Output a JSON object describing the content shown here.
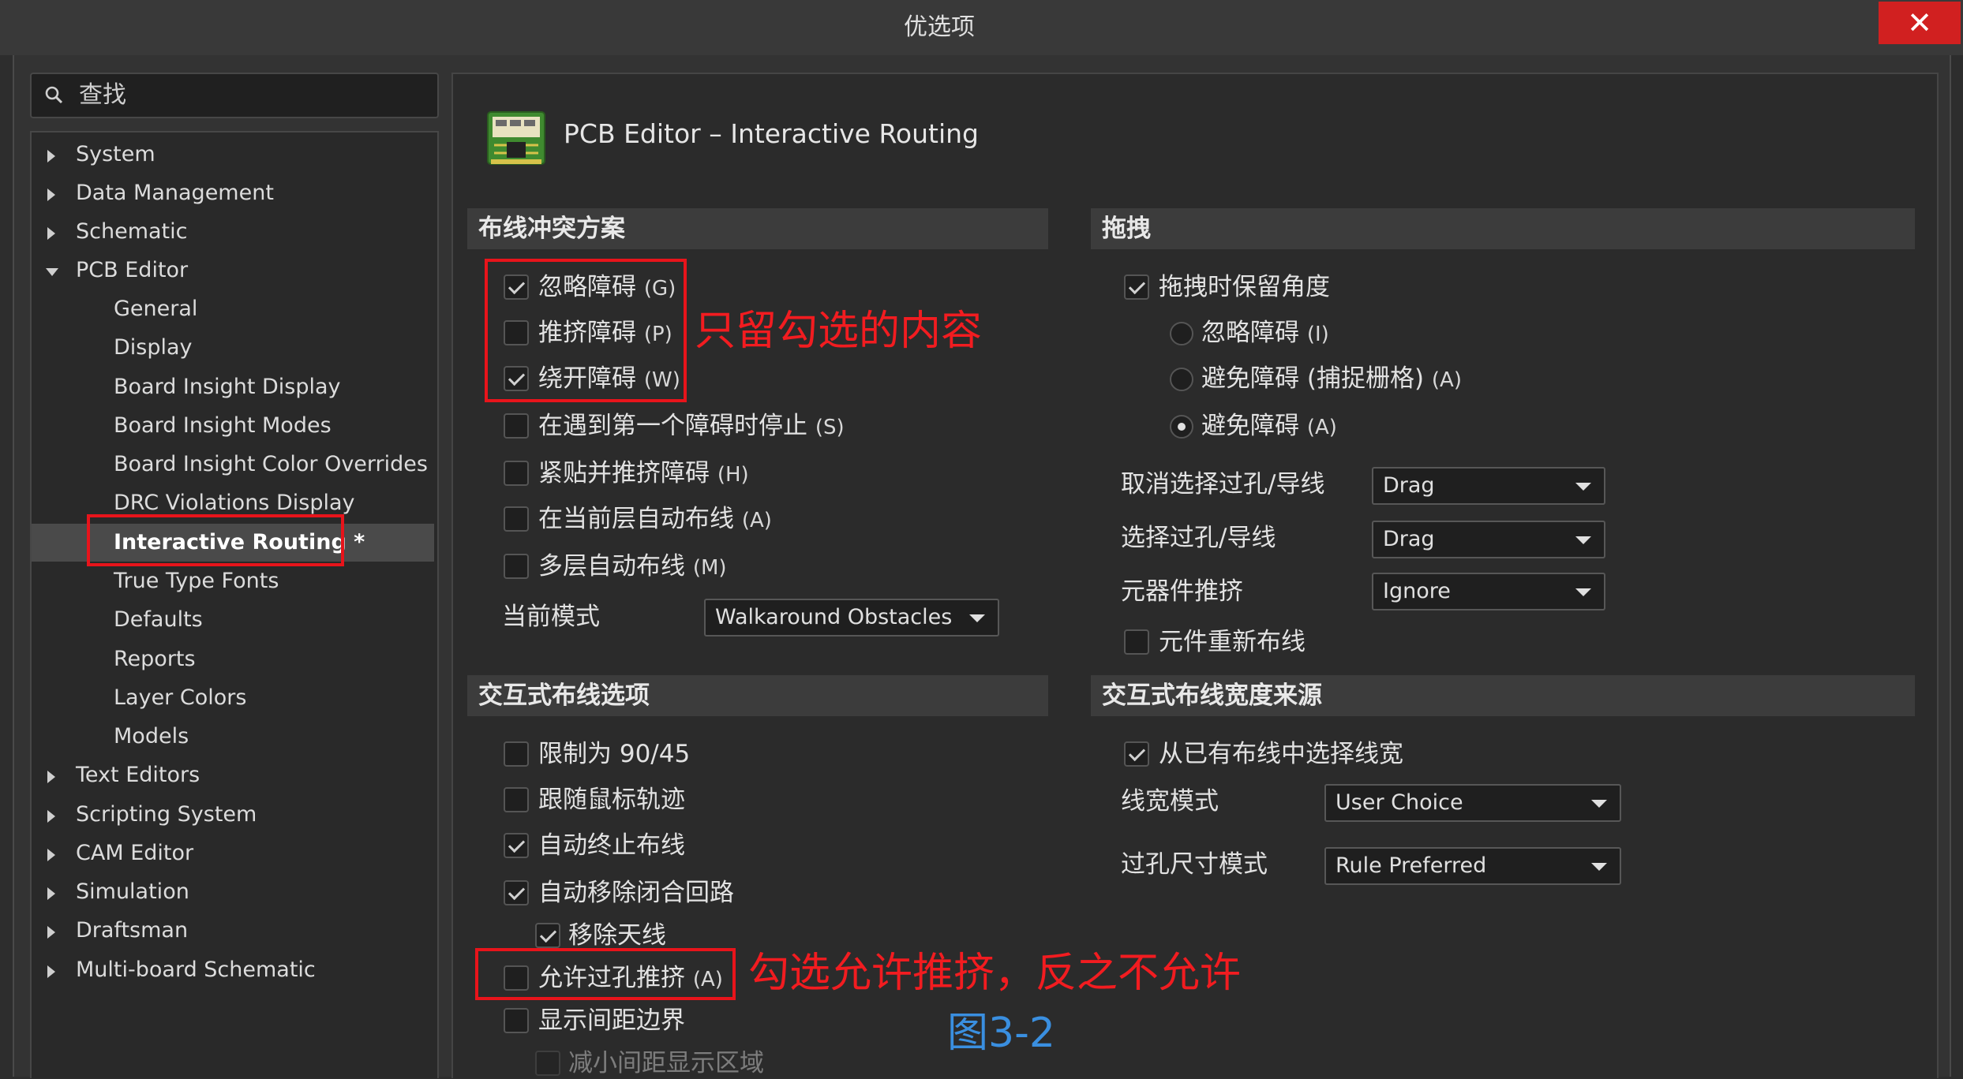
{
  "window": {
    "title": "优选项",
    "close_glyph": "✕"
  },
  "search": {
    "placeholder": "查找"
  },
  "tree": {
    "items": [
      {
        "label": "System",
        "expandable": true,
        "expanded": false
      },
      {
        "label": "Data Management",
        "expandable": true,
        "expanded": false
      },
      {
        "label": "Schematic",
        "expandable": true,
        "expanded": false
      },
      {
        "label": "PCB Editor",
        "expandable": true,
        "expanded": true
      },
      {
        "label": "General"
      },
      {
        "label": "Display"
      },
      {
        "label": "Board Insight Display"
      },
      {
        "label": "Board Insight Modes"
      },
      {
        "label": "Board Insight Color Overrides"
      },
      {
        "label": "DRC Violations Display"
      },
      {
        "label": "Interactive Routing *",
        "selected": true
      },
      {
        "label": "True Type Fonts"
      },
      {
        "label": "Defaults"
      },
      {
        "label": "Reports"
      },
      {
        "label": "Layer Colors"
      },
      {
        "label": "Models"
      },
      {
        "label": "Text Editors",
        "expandable": true,
        "expanded": false
      },
      {
        "label": "Scripting System",
        "expandable": true,
        "expanded": false
      },
      {
        "label": "CAM Editor",
        "expandable": true,
        "expanded": false
      },
      {
        "label": "Simulation",
        "expandable": true,
        "expanded": false
      },
      {
        "label": "Draftsman",
        "expandable": true,
        "expanded": false
      },
      {
        "label": "Multi-board Schematic",
        "expandable": true,
        "expanded": false
      }
    ]
  },
  "page": {
    "heading": "PCB Editor – Interactive Routing"
  },
  "conflict": {
    "header": "布线冲突方案",
    "options": [
      {
        "label": "忽略障碍",
        "accel": "(G)",
        "checked": true
      },
      {
        "label": "推挤障碍",
        "accel": "(P)",
        "checked": false
      },
      {
        "label": "绕开障碍",
        "accel": "(W)",
        "checked": true
      },
      {
        "label": "在遇到第一个障碍时停止",
        "accel": "(S)",
        "checked": false
      },
      {
        "label": "紧贴并推挤障碍",
        "accel": "(H)",
        "checked": false
      },
      {
        "label": "在当前层自动布线",
        "accel": "(A)",
        "checked": false
      },
      {
        "label": "多层自动布线",
        "accel": "(M)",
        "checked": false
      }
    ],
    "mode_label": "当前模式",
    "mode_value": "Walkaround Obstacles"
  },
  "drag": {
    "header": "拖拽",
    "keep_angle": {
      "label": "拖拽时保留角度",
      "checked": true
    },
    "radios": [
      {
        "label": "忽略障碍",
        "accel": "(I)",
        "selected": false
      },
      {
        "label": "避免障碍 (捕捉栅格)",
        "accel": "(A)",
        "selected": false
      },
      {
        "label": "避免障碍",
        "accel": "(A)",
        "selected": true
      }
    ],
    "fields": [
      {
        "label": "取消选择过孔/导线",
        "value": "Drag"
      },
      {
        "label": "选择过孔/导线",
        "value": "Drag"
      },
      {
        "label": "元器件推挤",
        "value": "Ignore"
      }
    ],
    "reroute": {
      "label": "元件重新布线",
      "checked": false
    }
  },
  "interactive": {
    "header": "交互式布线选项",
    "options": [
      {
        "label": "限制为 90/45",
        "accel": "",
        "checked": false
      },
      {
        "label": "跟随鼠标轨迹",
        "accel": "",
        "checked": false
      },
      {
        "label": "自动终止布线",
        "accel": "",
        "checked": true
      },
      {
        "label": "自动移除闭合回路",
        "accel": "",
        "checked": true
      },
      {
        "label": "移除天线",
        "accel": "",
        "checked": true,
        "indent": true
      },
      {
        "label": "允许过孔推挤",
        "accel": "(A)",
        "checked": false
      },
      {
        "label": "显示间距边界",
        "accel": "",
        "checked": false
      },
      {
        "label": "减小间距显示区域",
        "accel": "",
        "checked": false,
        "indent": true,
        "disabled": true
      }
    ]
  },
  "width_source": {
    "header": "交互式布线宽度来源",
    "pick_width": {
      "label": "从已有布线中选择线宽",
      "checked": true
    },
    "fields": [
      {
        "label": "线宽模式",
        "value": "User Choice"
      },
      {
        "label": "过孔尺寸模式",
        "value": "Rule Preferred"
      }
    ]
  },
  "annotations": {
    "note1": "只留勾选的内容",
    "note2": "勾选允许推挤，反之不允许",
    "figure": "图3-2"
  },
  "colors": {
    "annotation_red": "#e8141b",
    "figure_blue": "#3a8fe0",
    "close_red": "#d12020"
  }
}
